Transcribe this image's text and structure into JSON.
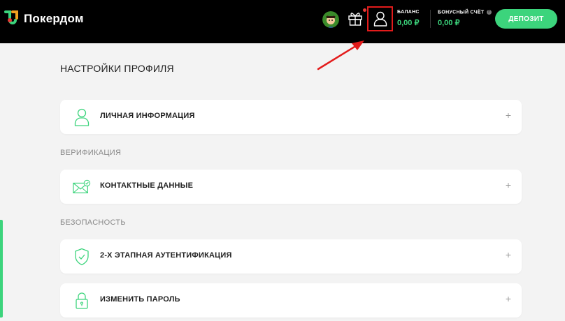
{
  "brand": {
    "name": "Покердом",
    "accent": "#3cd47c"
  },
  "header": {
    "balance_label": "БАЛАНС",
    "balance_value": "0,00 ₽",
    "bonus_label": "БОНУСНЫЙ СЧЁТ",
    "bonus_value": "0,00 ₽",
    "deposit_label": "ДЕПОЗИТ",
    "icons": [
      "avatar-icon",
      "gift-icon",
      "user-icon"
    ],
    "highlight_color": "#e31b1b"
  },
  "page": {
    "title": "НАСТРОЙКИ ПРОФИЛЯ"
  },
  "sections": {
    "personal": {
      "label": "ЛИЧНАЯ ИНФОРМАЦИЯ"
    },
    "verification_heading": "ВЕРИФИКАЦИЯ",
    "contacts": {
      "label": "КОНТАКТНЫЕ ДАННЫЕ"
    },
    "security_heading": "БЕЗОПАСНОСТЬ",
    "twofa": {
      "label": "2-Х ЭТАПНАЯ АУТЕНТИФИКАЦИЯ"
    },
    "password": {
      "label": "ИЗМЕНИТЬ ПАРОЛЬ"
    }
  },
  "expand_symbol": "+"
}
